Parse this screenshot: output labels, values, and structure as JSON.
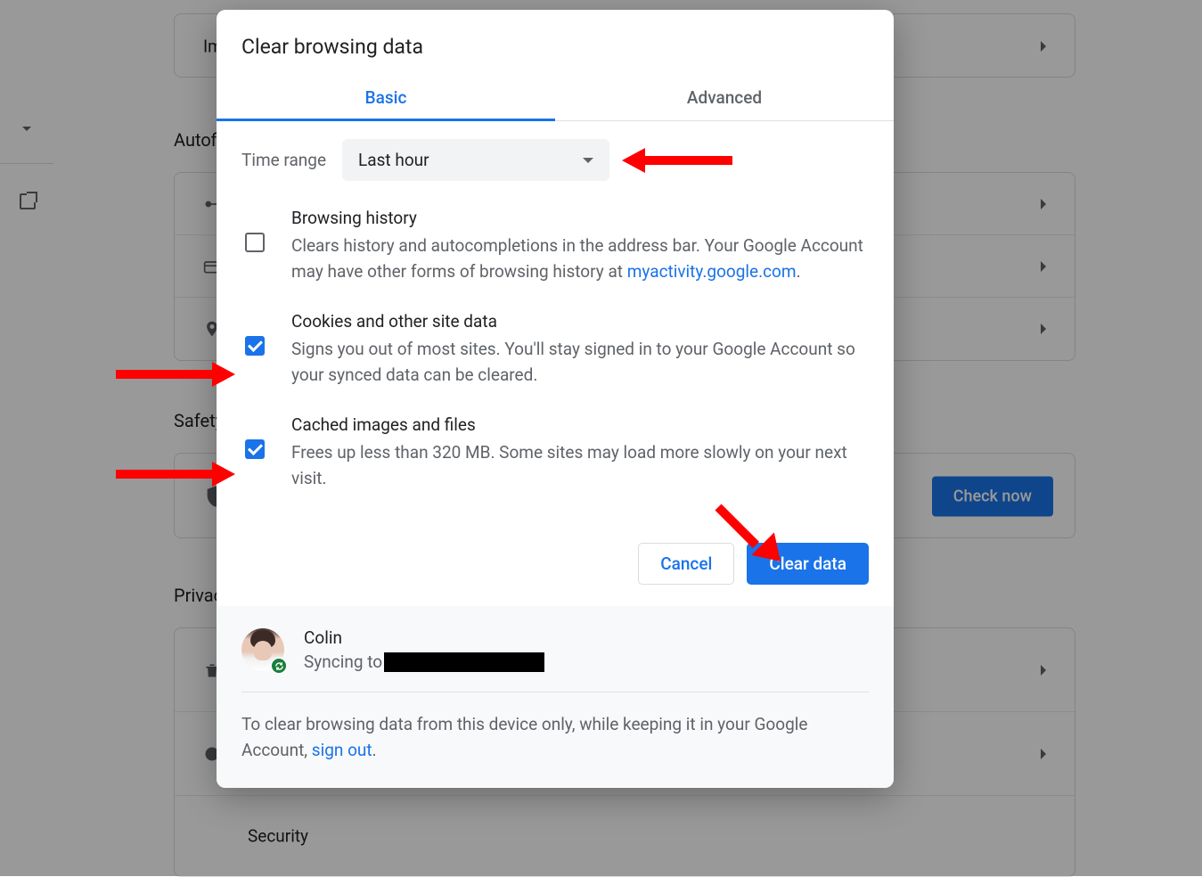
{
  "background": {
    "section_autofill": "Autofill",
    "section_safety": "Safety check",
    "section_privacy": "Privacy and security",
    "row_import": "Import bookmarks and settings",
    "row_security": "Security",
    "check_now": "Check now"
  },
  "modal": {
    "title": "Clear browsing data",
    "tabs": {
      "basic": "Basic",
      "advanced": "Advanced"
    },
    "time_range_label": "Time range",
    "time_range_value": "Last hour",
    "items": [
      {
        "title": "Browsing history",
        "desc_prefix": "Clears history and autocompletions in the address bar. Your Google Account may have other forms of browsing history at ",
        "link_text": "myactivity.google.com",
        "desc_suffix": ".",
        "checked": false
      },
      {
        "title": "Cookies and other site data",
        "desc": "Signs you out of most sites. You'll stay signed in to your Google Account so your synced data can be cleared.",
        "checked": true
      },
      {
        "title": "Cached images and files",
        "desc": "Frees up less than 320 MB. Some sites may load more slowly on your next visit.",
        "checked": true
      }
    ],
    "cancel": "Cancel",
    "clear": "Clear data",
    "sync": {
      "name": "Colin",
      "status_prefix": "Syncing to"
    },
    "footnote_prefix": "To clear browsing data from this device only, while keeping it in your Google Account, ",
    "footnote_link": "sign out",
    "footnote_suffix": "."
  }
}
